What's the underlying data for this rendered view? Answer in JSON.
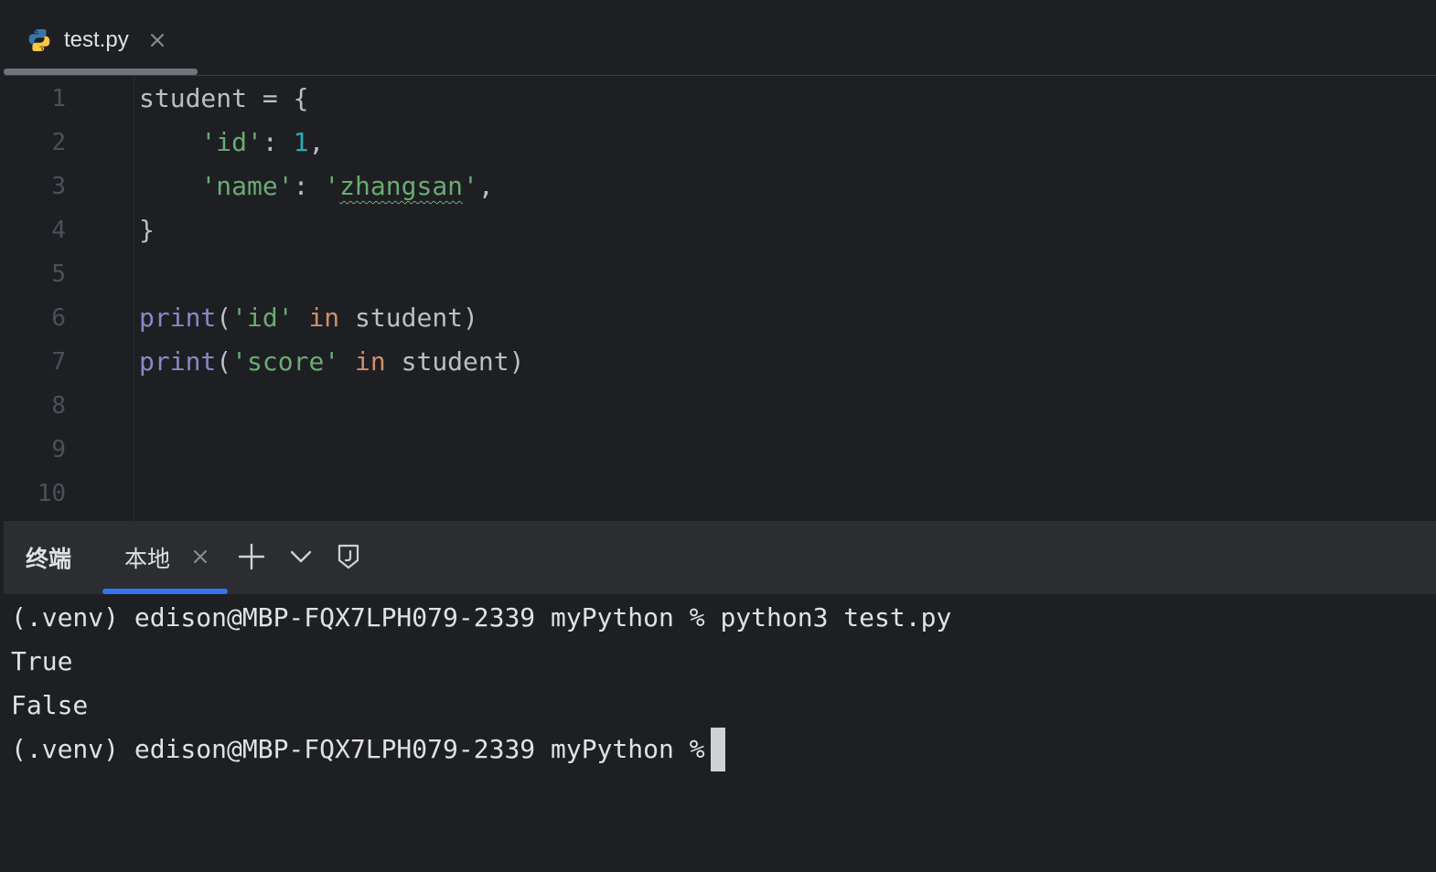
{
  "editor": {
    "tab": {
      "filename": "test.py",
      "icon": "python-icon"
    },
    "line_numbers": [
      "1",
      "2",
      "3",
      "4",
      "5",
      "6",
      "7",
      "8",
      "9",
      "10"
    ],
    "code": {
      "l1": "student = {",
      "l2_indent": "    ",
      "l2_key": "'id'",
      "l2_colon": ": ",
      "l2_val": "1",
      "l2_comma": ",",
      "l3_indent": "    ",
      "l3_key": "'name'",
      "l3_colon": ": ",
      "l3_q1": "'",
      "l3_val": "zhangsan",
      "l3_q2": "'",
      "l3_comma": ",",
      "l4": "}",
      "l6_fn": "print",
      "l6_open": "(",
      "l6_str": "'id'",
      "l6_kw": " in",
      "l6_rest": " student)",
      "l7_fn": "print",
      "l7_open": "(",
      "l7_str": "'score'",
      "l7_kw": " in",
      "l7_rest": " student)"
    }
  },
  "panel": {
    "title": "终端",
    "tab_label": "本地",
    "icons": [
      "close-icon",
      "plus-icon",
      "chevron-down-icon",
      "shield-icon"
    ]
  },
  "terminal": {
    "lines": [
      "(.venv) edison@MBP-FQX7LPH079-2339 myPython % python3 test.py",
      "True",
      "False",
      "(.venv) edison@MBP-FQX7LPH079-2339 myPython %"
    ]
  },
  "colors": {
    "background": "#1e1f22",
    "panel_header": "#2b2d30",
    "string": "#6aab73",
    "number": "#2aacb8",
    "builtin": "#8888c6",
    "keyword": "#cf8e6d",
    "accent": "#3574f0"
  }
}
